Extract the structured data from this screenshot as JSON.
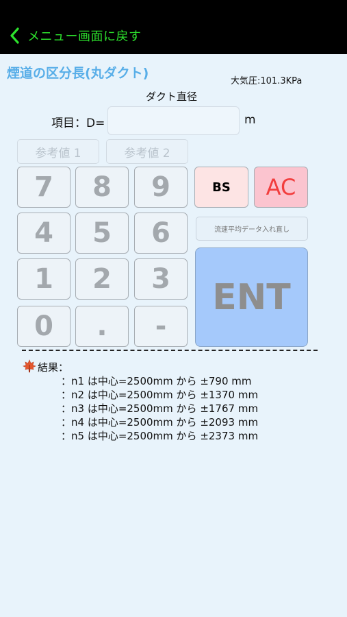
{
  "header": {
    "back_label": "メニュー画面に戻す"
  },
  "page": {
    "title": "煙道の区分長(丸ダクト)",
    "pressure": "大気圧:101.3KPa",
    "section_label": "ダクト直径",
    "item_label": "項目：D=",
    "input_value": "",
    "unit": "m"
  },
  "refs": {
    "ref1": "参考値 1",
    "ref2": "参考値 2"
  },
  "keypad": {
    "k7": "7",
    "k8": "8",
    "k9": "9",
    "k4": "4",
    "k5": "5",
    "k6": "6",
    "k1": "1",
    "k2": "2",
    "k3": "3",
    "k0": "0",
    "kdot": ".",
    "kminus": "-"
  },
  "actions": {
    "bs": "BS",
    "ac": "AC",
    "reenter": "流速平均データ入れ直し",
    "ent": "ENT"
  },
  "results": {
    "label": "結果：",
    "lines": [
      "：n1 は中心=2500mm から ±790 mm",
      "：n2 は中心=2500mm から ±1370 mm",
      "：n3 は中心=2500mm から ±1767 mm",
      "：n4 は中心=2500mm から ±2093 mm",
      "：n5 は中心=2500mm から ±2373 mm"
    ]
  },
  "colors": {
    "header_bg": "#000000",
    "back_text": "#2de12d",
    "title": "#58aee8",
    "background": "#e8f3fb",
    "ent_bg": "#a5c9fb",
    "ac_bg": "#fbc4cf",
    "ac_text": "#f23d3d",
    "bs_bg": "#fde4e4"
  },
  "icons": {
    "back": "chevron-left-icon",
    "result": "maple-leaf-icon"
  }
}
